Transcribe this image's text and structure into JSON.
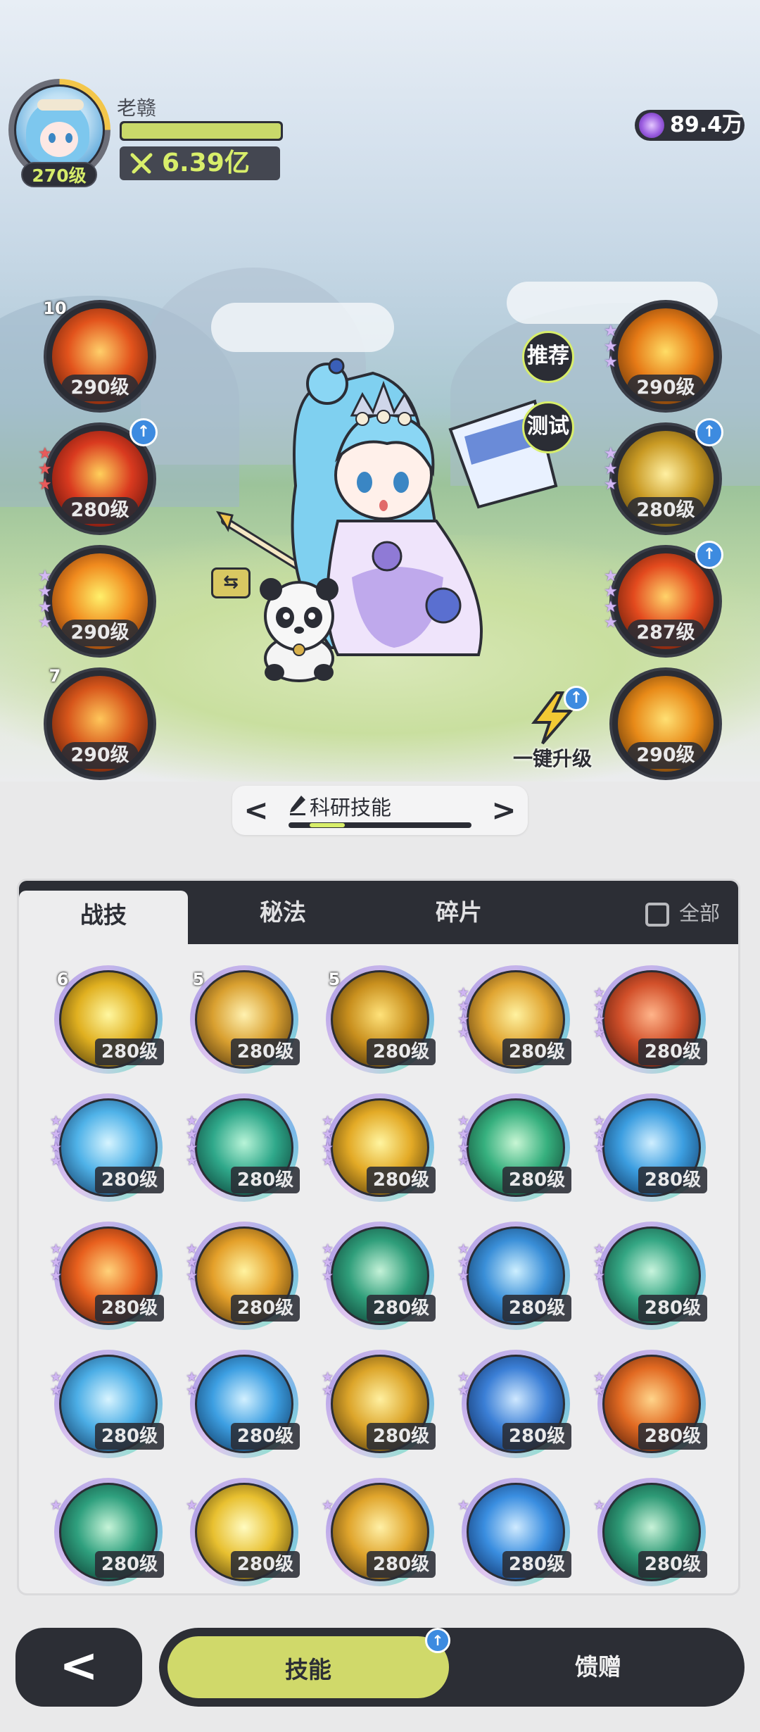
{
  "player": {
    "name": "老赣",
    "level": "270级",
    "exp_fraction": 1.0,
    "power": "6.39亿"
  },
  "currency": {
    "amount": "89.4万",
    "icon": "purple-gem-icon"
  },
  "side_buttons": {
    "recommend": "推荐",
    "test": "测试"
  },
  "one_key": {
    "label": "一键升级"
  },
  "left_skills": [
    {
      "level": "290级",
      "badge": "10",
      "stars": 0,
      "colors": [
        "#ffcf6a",
        "#e2531c",
        "#4a1208"
      ]
    },
    {
      "level": "280级",
      "badge": "",
      "stars": 3,
      "red": true,
      "upgrade": true,
      "colors": [
        "#ffd05b",
        "#d93a1f",
        "#4a0808"
      ]
    },
    {
      "level": "290级",
      "badge": "",
      "stars": 4,
      "colors": [
        "#fff06b",
        "#f08a1e",
        "#5a1a05"
      ]
    },
    {
      "level": "290级",
      "badge": "7",
      "stars": 0,
      "colors": [
        "#ffc65a",
        "#d7561b",
        "#3b0d05"
      ]
    }
  ],
  "right_skills": [
    {
      "level": "290级",
      "stars": 3,
      "colors": [
        "#ffdd66",
        "#e67a16",
        "#402006"
      ]
    },
    {
      "level": "280级",
      "stars": 3,
      "upgrade": true,
      "colors": [
        "#fff0a2",
        "#c99a24",
        "#3d2c08"
      ]
    },
    {
      "level": "287级",
      "stars": 4,
      "upgrade": true,
      "colors": [
        "#ffd36a",
        "#e34a1e",
        "#3b0e05"
      ]
    },
    {
      "level": "290级",
      "stars": 0,
      "colors": [
        "#ffe073",
        "#e88a18",
        "#3d1f06"
      ]
    }
  ],
  "switcher": {
    "title": "科研技能",
    "prev": "<",
    "next": ">"
  },
  "panel": {
    "tabs": [
      "战技",
      "秘法",
      "碎片"
    ],
    "active_tab": 0,
    "all_label": "全部"
  },
  "skills": [
    {
      "level": "280级",
      "badge": "6",
      "stars": 0,
      "colors": [
        "#fff7a0",
        "#e0b020",
        "#3a2a08"
      ]
    },
    {
      "level": "280级",
      "badge": "5",
      "stars": 0,
      "colors": [
        "#fff1b0",
        "#d9a030",
        "#3a2408"
      ]
    },
    {
      "level": "280级",
      "badge": "5",
      "stars": 0,
      "colors": [
        "#ffe27a",
        "#c9901e",
        "#2e1e06"
      ]
    },
    {
      "level": "280级",
      "badge": "",
      "stars": 4,
      "colors": [
        "#fff2a0",
        "#e0a532",
        "#3c2408"
      ]
    },
    {
      "level": "280级",
      "badge": "",
      "stars": 4,
      "colors": [
        "#ffb48a",
        "#d2502a",
        "#3a0e06"
      ]
    },
    {
      "level": "280级",
      "badge": "",
      "stars": 4,
      "colors": [
        "#d6f4ff",
        "#4fb2e8",
        "#0b2d55"
      ]
    },
    {
      "level": "280级",
      "badge": "",
      "stars": 4,
      "colors": [
        "#b8f4d8",
        "#2fa88a",
        "#06302a"
      ]
    },
    {
      "level": "280级",
      "badge": "",
      "stars": 4,
      "colors": [
        "#fff5a0",
        "#e3aa26",
        "#3e2a06"
      ]
    },
    {
      "level": "280级",
      "badge": "",
      "stars": 4,
      "colors": [
        "#c8f6d4",
        "#36b07e",
        "#0a3326"
      ]
    },
    {
      "level": "280级",
      "badge": "",
      "stars": 3,
      "colors": [
        "#cfeeff",
        "#3c9ee0",
        "#0a2a52"
      ]
    },
    {
      "level": "280级",
      "badge": "",
      "stars": 3,
      "colors": [
        "#ffd27a",
        "#e8601e",
        "#3d0e05"
      ]
    },
    {
      "level": "280级",
      "badge": "",
      "stars": 3,
      "colors": [
        "#fff3a0",
        "#e4a02a",
        "#3b2506"
      ]
    },
    {
      "level": "280级",
      "badge": "",
      "stars": 3,
      "colors": [
        "#c4f2d8",
        "#2f9e7a",
        "#072c26"
      ]
    },
    {
      "level": "280级",
      "badge": "",
      "stars": 3,
      "colors": [
        "#cdefff",
        "#3a8fd8",
        "#082648"
      ]
    },
    {
      "level": "280级",
      "badge": "",
      "stars": 3,
      "colors": [
        "#c8f4dd",
        "#34a683",
        "#083127"
      ]
    },
    {
      "level": "280级",
      "badge": "",
      "stars": 2,
      "colors": [
        "#d8f4ff",
        "#4caee6",
        "#0a2c52"
      ]
    },
    {
      "level": "280级",
      "badge": "",
      "stars": 2,
      "colors": [
        "#d2f0ff",
        "#3d9fe2",
        "#082a50"
      ]
    },
    {
      "level": "280级",
      "badge": "",
      "stars": 2,
      "colors": [
        "#fff0a0",
        "#dca52a",
        "#3a2606"
      ]
    },
    {
      "level": "280级",
      "badge": "",
      "stars": 2,
      "colors": [
        "#cfe8ff",
        "#3b7fd6",
        "#081f48"
      ]
    },
    {
      "level": "280级",
      "badge": "",
      "stars": 2,
      "colors": [
        "#ffd48a",
        "#e26a22",
        "#3b1006"
      ]
    },
    {
      "level": "280级",
      "badge": "",
      "stars": 1,
      "colors": [
        "#c6f4d8",
        "#2fa07e",
        "#072d26"
      ]
    },
    {
      "level": "280级",
      "badge": "",
      "stars": 1,
      "colors": [
        "#fffbc0",
        "#e8c030",
        "#3b2c06"
      ]
    },
    {
      "level": "280级",
      "badge": "",
      "stars": 1,
      "colors": [
        "#fff0a6",
        "#e0a52c",
        "#3b2606"
      ]
    },
    {
      "level": "280级",
      "badge": "",
      "stars": 1,
      "colors": [
        "#cfeaff",
        "#3a8ee0",
        "#081f50"
      ]
    },
    {
      "level": "280级",
      "badge": "",
      "stars": 1,
      "colors": [
        "#c8f2d8",
        "#2e9a76",
        "#062a24"
      ]
    }
  ],
  "bottom": {
    "back": "<",
    "tabs": [
      "技能",
      "馈赠"
    ],
    "active_tab": 0
  }
}
